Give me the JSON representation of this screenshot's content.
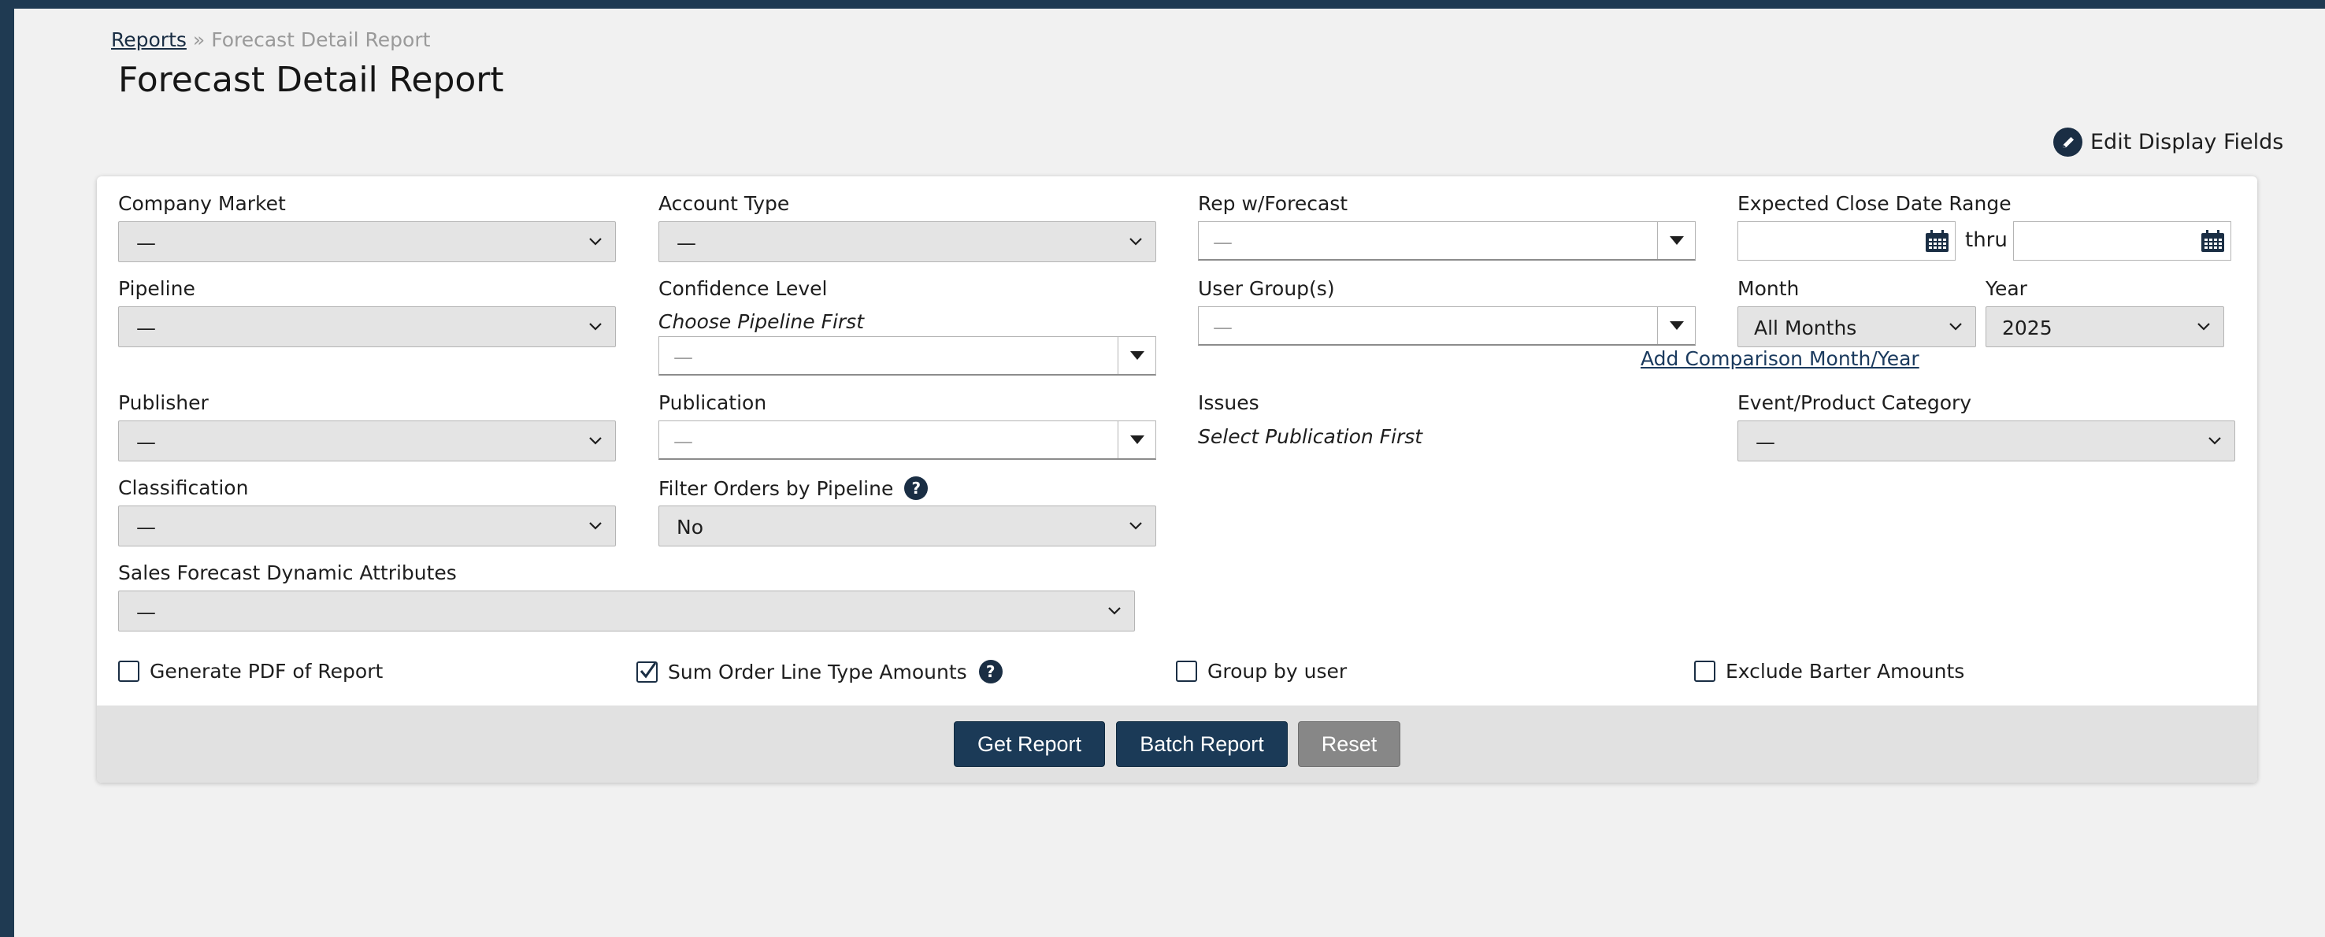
{
  "breadcrumb": {
    "root": "Reports",
    "separator": "»",
    "current": "Forecast Detail Report"
  },
  "page": {
    "title": "Forecast Detail Report"
  },
  "toolbar": {
    "edit_display_fields": "Edit Display Fields",
    "edit_icon": "pencil-icon"
  },
  "form": {
    "company_market": {
      "label": "Company Market",
      "value": "—"
    },
    "account_type": {
      "label": "Account Type",
      "value": "—"
    },
    "rep_forecast": {
      "label": "Rep w/Forecast",
      "value": "—"
    },
    "close_date_range": {
      "label": "Expected Close Date Range",
      "thru": "thru",
      "from_value": "",
      "to_value": ""
    },
    "pipeline": {
      "label": "Pipeline",
      "value": "—"
    },
    "confidence_level": {
      "label": "Confidence Level",
      "note": "Choose Pipeline First",
      "value": "—"
    },
    "user_groups": {
      "label": "User Group(s)",
      "value": "—"
    },
    "month": {
      "label": "Month",
      "value": "All Months"
    },
    "year": {
      "label": "Year",
      "value": "2025"
    },
    "add_comparison": "Add Comparison Month/Year",
    "publisher": {
      "label": "Publisher",
      "value": "—"
    },
    "publication": {
      "label": "Publication",
      "value": "—"
    },
    "issues": {
      "label": "Issues",
      "note": "Select Publication First"
    },
    "event_category": {
      "label": "Event/Product Category",
      "value": "—"
    },
    "classification": {
      "label": "Classification",
      "value": "—"
    },
    "filter_by_pipeline": {
      "label": "Filter Orders by Pipeline",
      "value": "No"
    },
    "dynamic_attributes": {
      "label": "Sales Forecast Dynamic Attributes",
      "value": "—"
    }
  },
  "options": {
    "generate_pdf": {
      "label": "Generate PDF of Report",
      "checked": false
    },
    "sum_line_type": {
      "label": "Sum Order Line Type Amounts",
      "checked": true
    },
    "group_by_user": {
      "label": "Group by user",
      "checked": false
    },
    "exclude_barter": {
      "label": "Exclude Barter Amounts",
      "checked": false
    }
  },
  "help_symbol": "?",
  "buttons": {
    "get_report": "Get Report",
    "batch_report": "Batch Report",
    "reset": "Reset"
  },
  "colors": {
    "primary": "#1b3a57",
    "secondary": "#878787",
    "select_bg": "#e4e4e4",
    "nav": "#1f3a52"
  }
}
